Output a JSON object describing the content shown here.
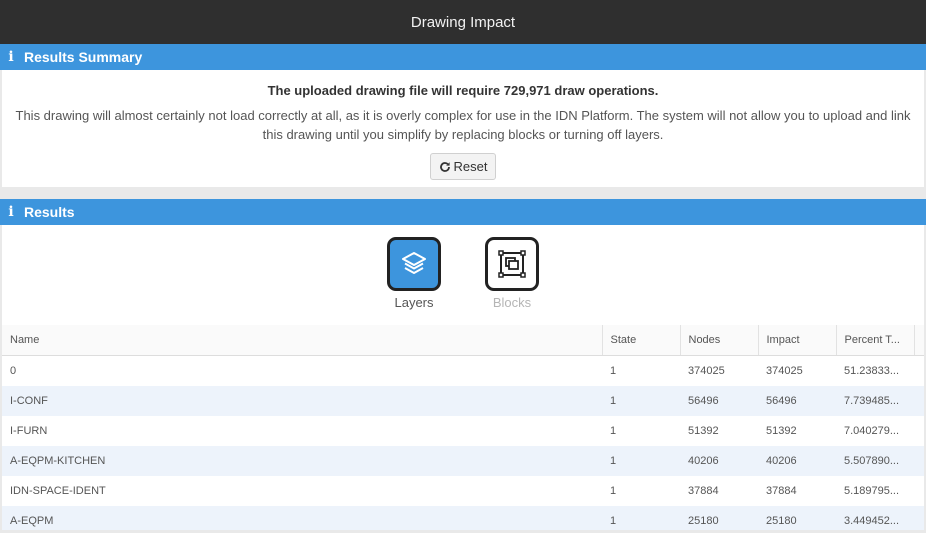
{
  "window": {
    "title": "Drawing Impact"
  },
  "summary": {
    "header": "Results Summary",
    "headline": "The uploaded drawing file will require 729,971 draw operations.",
    "description": "This drawing will almost certainly not load correctly at all, as it is overly complex for use in the IDN Platform. The system will not allow you to upload and link this drawing until you simplify by replacing blocks or turning off layers.",
    "reset_label": "Reset"
  },
  "results": {
    "header": "Results",
    "tabs": [
      {
        "label": "Layers",
        "icon": "layers-icon",
        "active": true
      },
      {
        "label": "Blocks",
        "icon": "blocks-icon",
        "active": false
      }
    ],
    "columns": [
      "Name",
      "State",
      "Nodes",
      "Impact",
      "Percent T..."
    ],
    "rows": [
      [
        "0",
        "1",
        "374025",
        "374025",
        "51.23833..."
      ],
      [
        "I-CONF",
        "1",
        "56496",
        "56496",
        "7.739485..."
      ],
      [
        "I-FURN",
        "1",
        "51392",
        "51392",
        "7.040279..."
      ],
      [
        "A-EQPM-KITCHEN",
        "1",
        "40206",
        "40206",
        "5.507890..."
      ],
      [
        "IDN-SPACE-IDENT",
        "1",
        "37884",
        "37884",
        "5.189795..."
      ],
      [
        "A-EQPM",
        "1",
        "25180",
        "25180",
        "3.449452..."
      ]
    ]
  },
  "colors": {
    "accent": "#3d95dd",
    "titlebar": "#2f2f2f"
  }
}
